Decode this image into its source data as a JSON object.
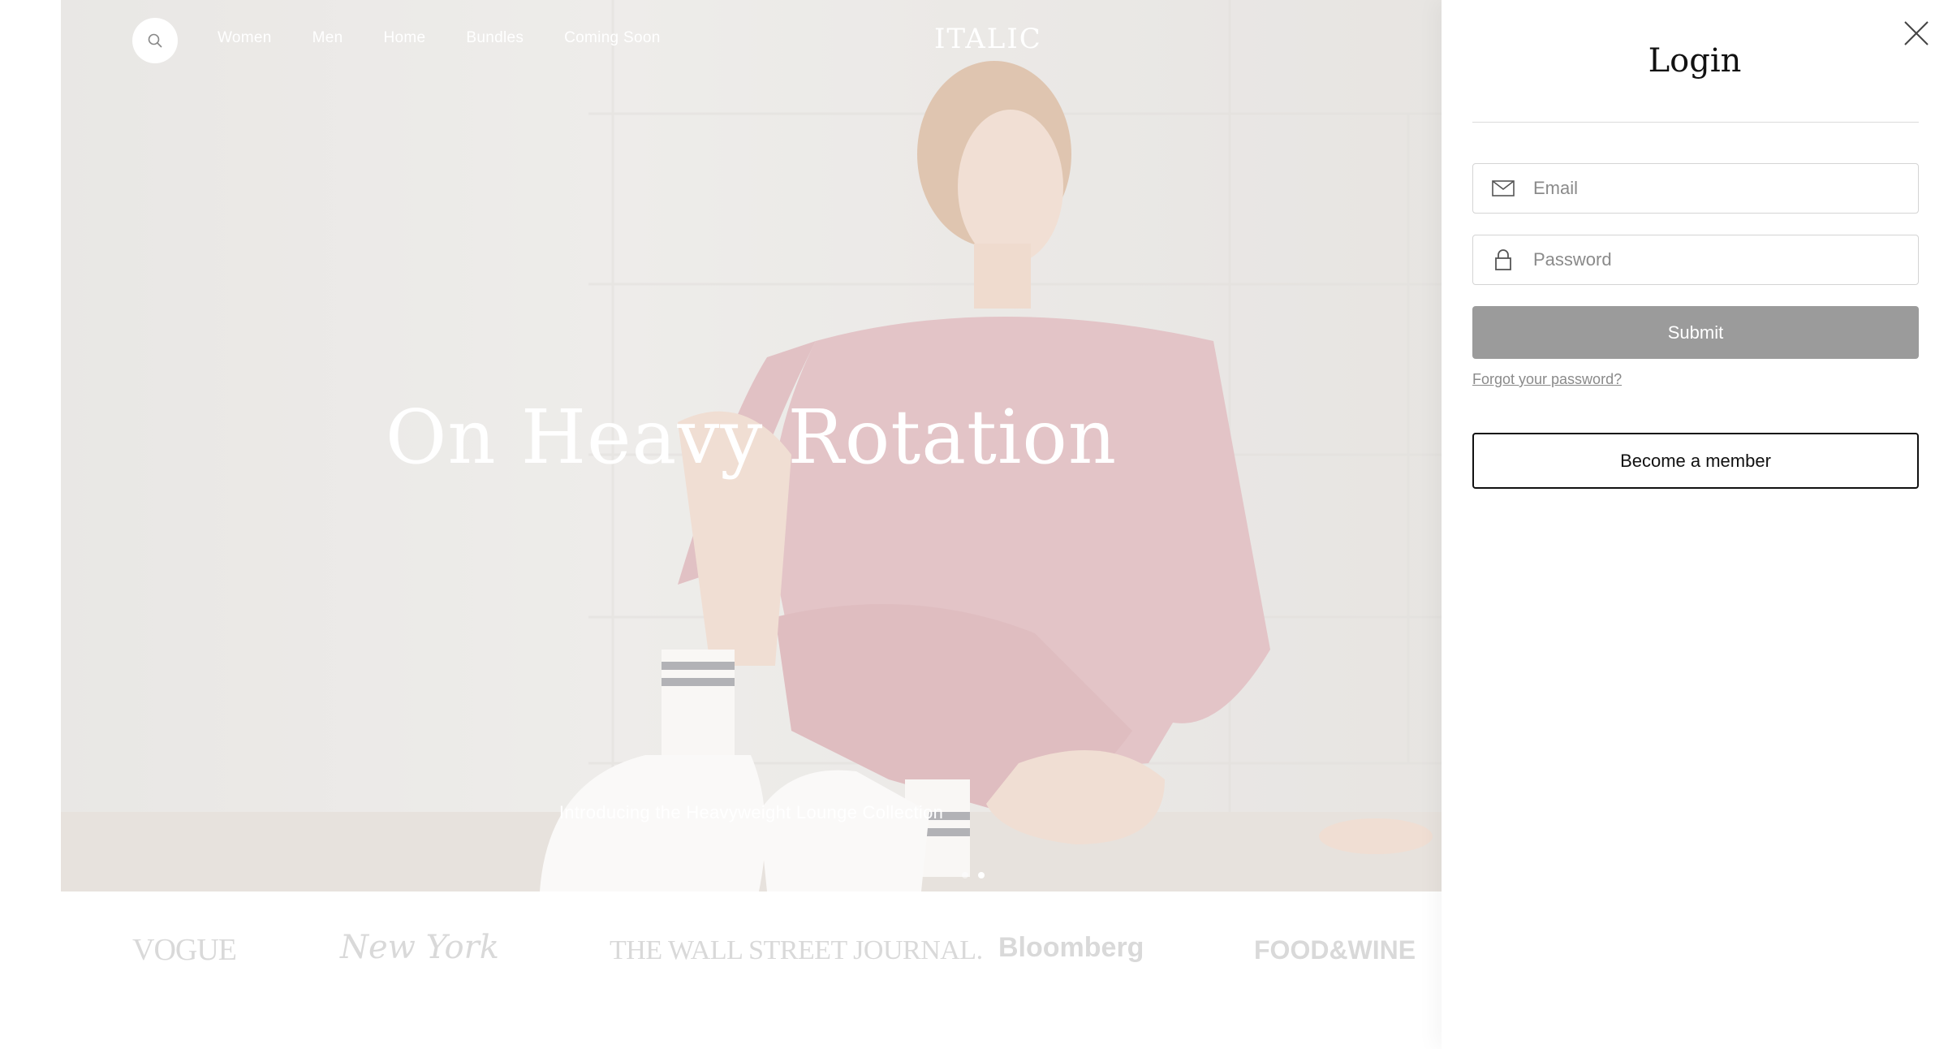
{
  "nav": {
    "links": [
      "Women",
      "Men",
      "Home",
      "Bundles",
      "Coming Soon"
    ],
    "logo": "ITALIC"
  },
  "hero": {
    "title": "On Heavy Rotation",
    "subtitle": "Introducing the Heavyweight Lounge Collection",
    "slides_total": 2,
    "active_slide": 2
  },
  "press": [
    "VOGUE",
    "New York",
    "THE WALL STREET JOURNAL.",
    "Bloomberg",
    "FOOD&WINE"
  ],
  "login": {
    "title": "Login",
    "email_placeholder": "Email",
    "password_placeholder": "Password",
    "submit_label": "Submit",
    "forgot_label": "Forgot your password?",
    "member_label": "Become a member"
  },
  "colors": {
    "submit_bg": "#9b9b9b",
    "member_border": "#111111",
    "sweater": "#c77f86"
  },
  "icons": {
    "search": "search-icon",
    "email": "mail-icon",
    "password": "lock-icon",
    "close": "close-icon"
  }
}
